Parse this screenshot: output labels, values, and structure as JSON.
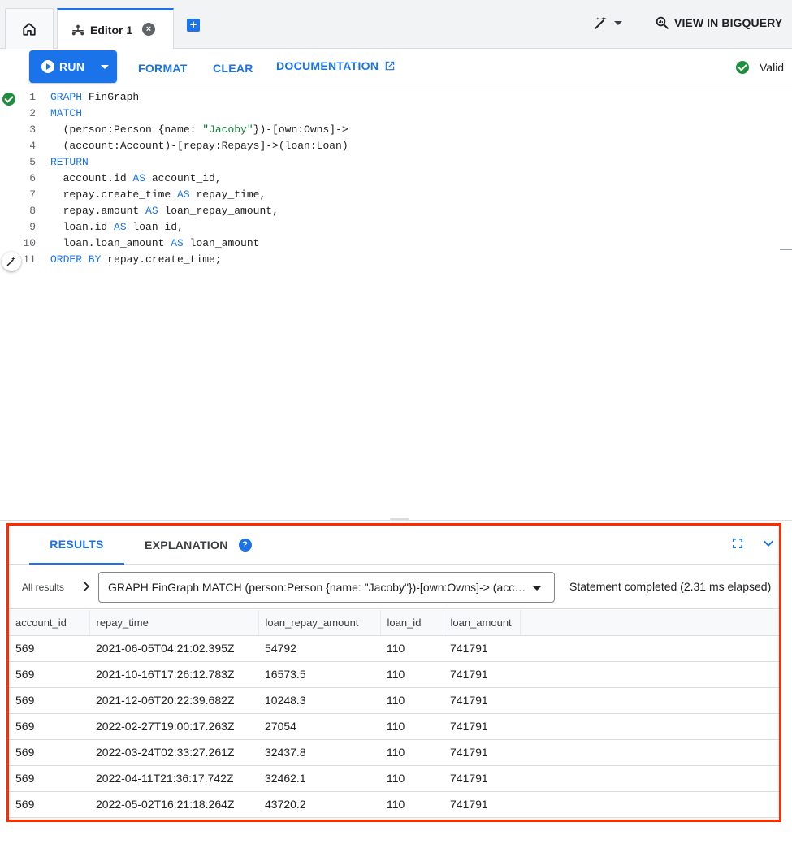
{
  "tabs": {
    "editor_label": "Editor 1",
    "view_in_bigquery": "VIEW IN BIGQUERY"
  },
  "toolbar": {
    "run_label": "RUN",
    "format_label": "FORMAT",
    "clear_label": "CLEAR",
    "documentation_label": "DOCUMENTATION",
    "status_label": "Valid"
  },
  "editor": {
    "line_numbers": [
      "1",
      "2",
      "3",
      "4",
      "5",
      "6",
      "7",
      "8",
      "9",
      "10",
      "11"
    ]
  },
  "results": {
    "tab_results": "RESULTS",
    "tab_explanation": "EXPLANATION",
    "all_results_label": "All results",
    "statement_select_value": "GRAPH FinGraph MATCH (person:Person {name: \"Jacoby\"})-[own:Owns]-> (account:Account)-[repay:Repays]->(loan:Loan) RETURN account.id AS account_id,",
    "statement_status": "Statement completed (2.31 ms elapsed)",
    "columns": [
      "account_id",
      "repay_time",
      "loan_repay_amount",
      "loan_id",
      "loan_amount"
    ],
    "rows": [
      [
        "569",
        "2021-06-05T04:21:02.395Z",
        "54792",
        "110",
        "741791"
      ],
      [
        "569",
        "2021-10-16T17:26:12.783Z",
        "16573.5",
        "110",
        "741791"
      ],
      [
        "569",
        "2021-12-06T20:22:39.682Z",
        "10248.3",
        "110",
        "741791"
      ],
      [
        "569",
        "2022-02-27T19:00:17.263Z",
        "27054",
        "110",
        "741791"
      ],
      [
        "569",
        "2022-03-24T02:33:27.261Z",
        "32437.8",
        "110",
        "741791"
      ],
      [
        "569",
        "2022-04-11T21:36:17.742Z",
        "32462.1",
        "110",
        "741791"
      ],
      [
        "569",
        "2022-05-02T16:21:18.264Z",
        "43720.2",
        "110",
        "741791"
      ]
    ]
  },
  "colors": {
    "accent": "#1a73e8",
    "valid_green": "#1e8e3e",
    "highlight_border": "#ff2a00",
    "string_green": "#188038"
  },
  "icons": [
    "home-icon",
    "graph-icon",
    "close-icon",
    "add-tab-icon",
    "magic-wand-icon",
    "search-icon",
    "play-icon",
    "external-link-icon",
    "check-circle-icon",
    "help-icon",
    "fullscreen-icon",
    "chevron-down-icon",
    "chevron-right-icon"
  ]
}
